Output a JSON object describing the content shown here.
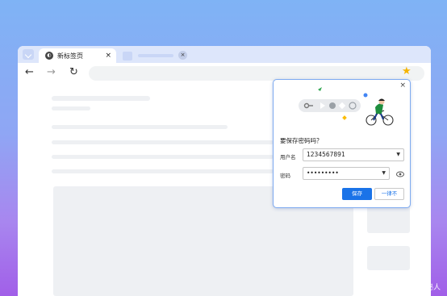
{
  "tabs": [
    {
      "title": "新标签页",
      "close": "×",
      "active": true
    },
    {
      "title": "",
      "close": "×",
      "active": false
    }
  ],
  "toolbar": {
    "back_icon": "←",
    "forward_icon": "→",
    "reload_icon": "↻",
    "bookmark_icon": "★"
  },
  "password_dialog": {
    "close": "×",
    "title": "要保存密码吗？",
    "username_label": "用户名",
    "username_value": "1234567891",
    "password_label": "密码",
    "password_value": "•••••••••",
    "save_button": "保存",
    "never_button": "一律不"
  },
  "watermark": "CSDN @科技探秘人",
  "colors": {
    "accent": "#1a73e8",
    "bookmark_star": "#f5b400",
    "tabstrip": "#dde6fb"
  }
}
